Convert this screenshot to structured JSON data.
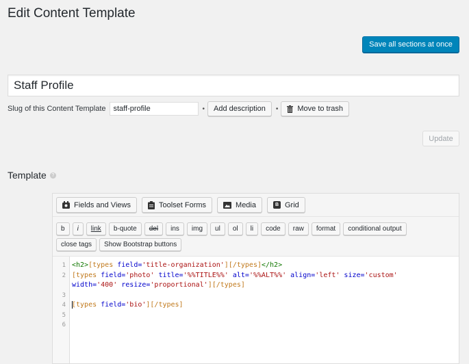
{
  "page": {
    "title": "Edit Content Template"
  },
  "actions": {
    "save_all": "Save all sections at once",
    "update": "Update"
  },
  "template_title": {
    "value": "Staff Profile"
  },
  "slug": {
    "label": "Slug of this Content Template",
    "value": "staff-profile",
    "separator": "•",
    "add_description": "Add description",
    "move_to_trash": "Move to trash"
  },
  "section": {
    "title": "Template",
    "help": "?"
  },
  "toolbar_main": [
    {
      "label": "Fields and Views",
      "icon": "fields-views-icon"
    },
    {
      "label": "Toolset Forms",
      "icon": "forms-clipboard-icon"
    },
    {
      "label": "Media",
      "icon": "media-image-icon"
    },
    {
      "label": "Grid",
      "icon": "bootstrap-grid-icon",
      "glyph": "B"
    }
  ],
  "quicktags": [
    "b",
    "i",
    "link",
    "b-quote",
    "del",
    "ins",
    "img",
    "ul",
    "ol",
    "li",
    "code",
    "raw",
    "format",
    "conditional output",
    "close tags",
    "Show Bootstrap buttons"
  ],
  "code": {
    "line_numbers": [
      "1",
      "2",
      "",
      "3",
      "4",
      "5",
      "6"
    ],
    "lines": [
      {
        "t1": "<h2>",
        "t2": "[types ",
        "t3": "field=",
        "t4": "'title-organization'",
        "t5": "][/types]",
        "t6": "</h2>"
      },
      {
        "a1": "[types ",
        "a2": "field=",
        "a3": "'photo'",
        "a4": " title=",
        "a5": "'%%TITLE%%'",
        "a6": " alt=",
        "a7": "'%%ALT%%'",
        "a8": " align=",
        "a9": "'left'",
        "a10": " size=",
        "a11": "'custom'"
      },
      {
        "b1": "width=",
        "b2": "'400'",
        "b3": " resize=",
        "b4": "'proportional'",
        "b5": "][/types]"
      },
      {
        "text": ""
      },
      {
        "c1": "[types ",
        "c2": "field=",
        "c3": "'bio'",
        "c4": "][/types]"
      },
      {
        "text": ""
      },
      {
        "text": ""
      }
    ]
  },
  "colors": {
    "primary": "#0085ba",
    "background": "#f1f1f1",
    "tag": "#117700",
    "shortcode": "#c0781a",
    "attribute": "#0000cc",
    "string": "#aa1111"
  }
}
